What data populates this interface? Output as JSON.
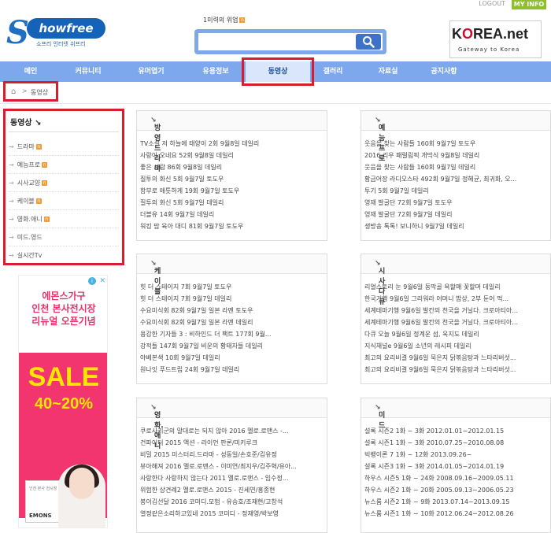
{
  "topbar": {
    "logout": "LOGOUT",
    "myinfo": "MY INFO"
  },
  "logo": {
    "mark": "S",
    "word": "howfree",
    "tagline": "쇼프리 인터넷 쉬프리"
  },
  "search": {
    "hotword_label": "1미력의 위엄",
    "hot_badge": "n",
    "placeholder": "",
    "value": ""
  },
  "partner": {
    "brand_k": "K",
    "brand_o": "O",
    "brand_rest": "REA.net",
    "tagline": "Gateway to Korea"
  },
  "nav": {
    "items": [
      {
        "label": "메인"
      },
      {
        "label": "커뮤니티"
      },
      {
        "label": "유머엽기"
      },
      {
        "label": "유용정보"
      },
      {
        "label": "동영상"
      },
      {
        "label": "갤러리"
      },
      {
        "label": "자료실"
      },
      {
        "label": "공지사항"
      }
    ]
  },
  "breadcrumb": {
    "home_icon": "⌂",
    "sep": ">",
    "current": "동영상"
  },
  "sidebar": {
    "title": "동영상",
    "arrow": "↘",
    "bullet": "→",
    "items": [
      {
        "label": "드라마",
        "badge": "n"
      },
      {
        "label": "예능프로",
        "badge": "n"
      },
      {
        "label": "시사교양",
        "badge": "n"
      },
      {
        "label": "케이블",
        "badge": "n"
      },
      {
        "label": "영화.애니",
        "badge": "n"
      },
      {
        "label": "미드.영드",
        "badge": ""
      },
      {
        "label": "실시간Tv",
        "badge": ""
      }
    ]
  },
  "ad": {
    "headline": "에몬스가구\n인천 본사전시장\n리뉴얼 오픈기념",
    "sale": "SALE",
    "percent": "40~20%",
    "card_text": "인천 본사 전시장",
    "brand": "EMONS",
    "choice_icon": "i",
    "close_icon": "✕"
  },
  "boxes": {
    "drama": {
      "title": "방영드라마",
      "items": [
        "TV소설 저 하늘에 태양이 2회 9월8일 데일리",
        "사랑이 오네요 52회 9월8일 데일리",
        "좋은 사람 86회 9월8일 데일리",
        "질투의 화신 5회 9월7일 토도우",
        "함부로 애틋하게 19회 9월7일 토도우",
        "질투의 화신 5회 9월7일 데일리",
        "더블유 14회 9월7일 데일리",
        "워킹 맘 육아 대디 81회 9월7일 토도우"
      ]
    },
    "variety": {
      "title": "예능프로",
      "items": [
        "웃음을 찾는 사람들 160회 9월7일 토도우",
        "2016 리우 패럴림픽 개막식 9월8일 데일리",
        "웃음을 찾는 사람들 160회 9월7일 데일리",
        "황금어장 라디오스타 492회 9월7일 정해균, 최귀화, 오...",
        "투기 5회 9월7일 데일리",
        "영재 발굴단 72회 9월7일 토도우",
        "영재 발굴단 72회 9월7일 데일리",
        "생방송 톡톡! 보니하니 9월7일 데일리"
      ]
    },
    "cable": {
      "title": "케이블",
      "items": [
        "힛 더 스테이지 7회 9월7일 토도우",
        "힛 더 스테이지 7회 9월7일 데일리",
        "수요미식회 82회 9월7일 일본 라멘 토도우",
        "수요미식회 82회 9월7일 일본 라멘 데일리",
        "용감한 기자들 3 : 비하인드 더 팩트 177회 9월...",
        "강적들 147회 9월7일 비운의 황태자들 데일리",
        "야베본색 10회 9월7일 데일리",
        "원나잇 푸드트립 24회 9월7일 데일리"
      ]
    },
    "current": {
      "title": "시사다큐",
      "items": [
        "리얼스토리 눈 9월6일 동막골 욕할매 꽃할머 데일리",
        "한국기행 9월6일 그리워라 어머니 밥상, 2부 둔어 먹...",
        "세계테마기행 9월6일 발칸의 천국을 거닐다. 크로아티아...",
        "세계테마기행 9월6일 발칸의 천국을 거닐다. 크로아티아...",
        "다큐 오늘 9월6일 정계운 섬, 욱지도 데일리",
        "지식채널e 9월6일 소년의 레시피 데일리",
        "최고의 요리비결 9월6일 묵은지 닭볶음탕과 느타리버섯...",
        "최고의 요리비결 9월6일 묵은지 닭볶음탕과 느타리버섯..."
      ]
    },
    "movie": {
      "title": "영화.애니",
      "items": [
        "쿠로사키군의 말대로는 되지 않아 2016 멜로.로맨스 -...",
        "건파이터 2015 액션 - 라이언 판론/미키루크",
        "비밀 2015 미스터리.드라마 - 성동일/손호준/김유정",
        "뷰아해져 2016 멜로.로맨스 - 이미연/최지우/김주혁/유아...",
        "사랑한다 사랑하지 않는다 2011 멜로.로맨스 - 임수정...",
        "위험한 상견례2 멜로.로맨스 2015 - 진세연/홍종현",
        "봉이김선달 2016 코미디.모험 - 유승호/조재현/고창석",
        "열정같은소리하고있네 2015 코미디 - 정재영/박보영"
      ]
    },
    "mid": {
      "title": "미드",
      "items": [
        "설록 시즌2 1화 ~ 3화 2012.01.01~2012.01.15",
        "설록 시즌1 1화 ~ 3화 2010.07.25~2010.08.08",
        "빅뱅이론 7 1화 ~ 12화 2013.09.26~",
        "설록 시즌3 1화 ~ 3화 2014.01.05~2014.01.19",
        "하우스 시즌5 1화 ~ 24화 2008.09.16~2009.05.11",
        "하우스 시즌2 1화 ~ 20화 2005.09.13~2006.05.23",
        "뉴스룸 시즌2 1화 ~ 9화 2013.07.14~2013.09.15",
        "뉴스룸 시즌1 1화 ~ 10화 2012.06.24~2012.08.26"
      ]
    }
  },
  "box_arrow": "↘"
}
